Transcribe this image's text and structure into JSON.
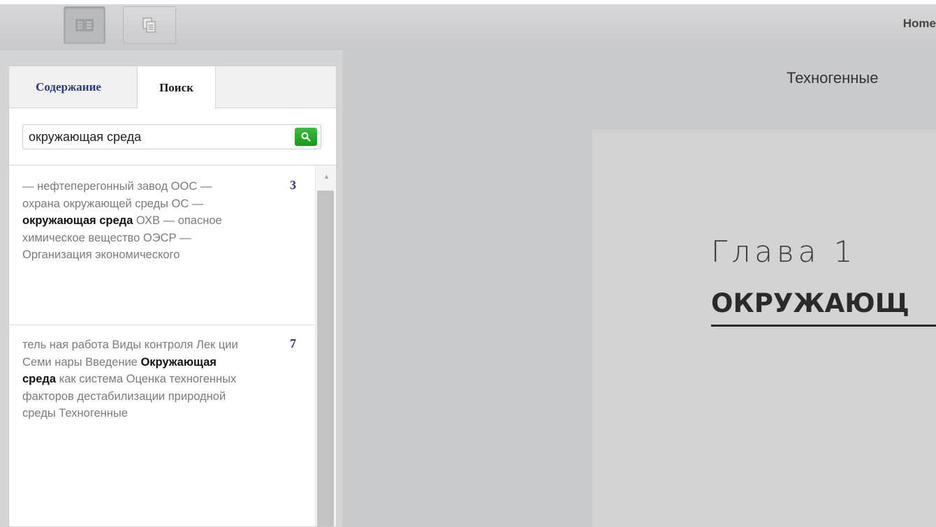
{
  "toolbar": {
    "book_view_icon": "open-book-icon",
    "page_view_icon": "pages-icon",
    "home_link": "Home"
  },
  "sidebar": {
    "tabs": [
      {
        "label": "Содержание"
      },
      {
        "label": "Поиск"
      }
    ],
    "search": {
      "value": "окружающая среда",
      "button_icon": "search-icon"
    },
    "results": [
      {
        "before": "— нефтеперегонный завод ООС — охрана окружающей среды ОС — ",
        "match": "окружающая среда",
        "after": " ОХВ — опасное химическое вещество ОЭСР — Организация экономического",
        "page": "3"
      },
      {
        "before": "тель ная работа Виды контроля Лек ции Семи нары Введение ",
        "match": "Окружающая среда",
        "after": " как система Оценка техногенных факторов дестабилизации природной среды Техногенные",
        "page": "7"
      }
    ]
  },
  "main": {
    "book_title": "Техногенные",
    "chapter_label": "Глава 1",
    "chapter_heading": "ОКРУЖАЮЩ"
  }
}
